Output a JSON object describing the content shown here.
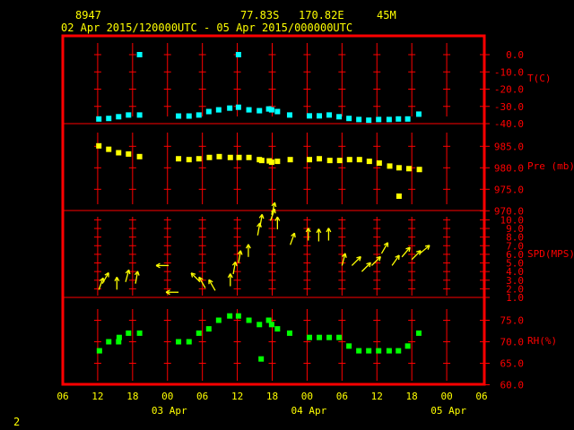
{
  "header": {
    "station": "8947",
    "lat": "77.83S",
    "lon": "170.82E",
    "elev": "45M",
    "range": "02 Apr 2015/120000UTC - 05 Apr 2015/000000UTC"
  },
  "footer": {
    "page": "2"
  },
  "colors": {
    "frame": "#ff0000",
    "text": "#ffff00",
    "temp": "#00ffff",
    "pres": "#ffff00",
    "wind": "#ffff00",
    "rh": "#00ff00"
  },
  "chart_data": {
    "type": "scatter",
    "title": "8947  77.83S 170.82E 45M",
    "x_units": "hours since 02 Apr 2015 00UTC",
    "xlim": [
      6,
      78
    ],
    "x_ticks": [
      {
        "h": 6,
        "label": "06"
      },
      {
        "h": 12,
        "label": "12"
      },
      {
        "h": 18,
        "label": "18"
      },
      {
        "h": 24,
        "label": "00"
      },
      {
        "h": 30,
        "label": "06"
      },
      {
        "h": 36,
        "label": "12"
      },
      {
        "h": 42,
        "label": "18"
      },
      {
        "h": 48,
        "label": "00"
      },
      {
        "h": 54,
        "label": "06"
      },
      {
        "h": 60,
        "label": "12"
      },
      {
        "h": 66,
        "label": "18"
      },
      {
        "h": 72,
        "label": "00"
      },
      {
        "h": 78,
        "label": "06"
      }
    ],
    "date_labels": [
      {
        "h": 24,
        "label": "03 Apr"
      },
      {
        "h": 48,
        "label": "04 Apr"
      },
      {
        "h": 72,
        "label": "05 Apr"
      }
    ],
    "panels": [
      {
        "id": "temp",
        "ylabel": "T(C)",
        "ylim": [
          -40,
          0
        ],
        "ticks": [
          "0.0",
          "-10.0",
          "-20.0",
          "-30.0",
          "-40.0"
        ],
        "tick_values": [
          0,
          -10,
          -20,
          -30,
          -40
        ],
        "points": [
          [
            12.2,
            -37.3
          ],
          [
            13.9,
            -37
          ],
          [
            15.6,
            -36
          ],
          [
            17.3,
            -35
          ],
          [
            19.2,
            -35
          ],
          [
            19.2,
            0
          ],
          [
            25.9,
            -35.6
          ],
          [
            27.7,
            -35.6
          ],
          [
            29.4,
            -35
          ],
          [
            31.1,
            -33
          ],
          [
            32.8,
            -32
          ],
          [
            34.7,
            -31
          ],
          [
            36.2,
            -30.5
          ],
          [
            36.2,
            0
          ],
          [
            38.0,
            -32
          ],
          [
            39.8,
            -32.5
          ],
          [
            41.4,
            -31.5
          ],
          [
            41.9,
            -32
          ],
          [
            42.9,
            -33
          ],
          [
            45.0,
            -35
          ],
          [
            48.4,
            -35.5
          ],
          [
            50.1,
            -35.5
          ],
          [
            51.8,
            -35
          ],
          [
            53.5,
            -36
          ],
          [
            55.2,
            -37
          ],
          [
            56.9,
            -37.6
          ],
          [
            58.6,
            -38
          ],
          [
            60.3,
            -37.6
          ],
          [
            62.1,
            -37.6
          ],
          [
            63.7,
            -37.3
          ],
          [
            65.3,
            -37.3
          ],
          [
            67.2,
            -34.5
          ]
        ]
      },
      {
        "id": "pres",
        "ylabel": "Pre (mb)",
        "ylim": [
          970,
          990
        ],
        "ticks": [
          "985.0",
          "980.0",
          "975.0",
          "970.0"
        ],
        "tick_values": [
          985,
          980,
          975,
          970
        ],
        "points": [
          [
            12.2,
            985.1
          ],
          [
            13.9,
            984.3
          ],
          [
            15.6,
            983.5
          ],
          [
            17.3,
            983.2
          ],
          [
            19.2,
            982.6
          ],
          [
            25.9,
            982.1
          ],
          [
            27.7,
            981.9
          ],
          [
            29.4,
            982.1
          ],
          [
            31.2,
            982.4
          ],
          [
            32.9,
            982.6
          ],
          [
            34.8,
            982.4
          ],
          [
            36.3,
            982.4
          ],
          [
            38.0,
            982.4
          ],
          [
            39.8,
            981.9
          ],
          [
            40.2,
            981.7
          ],
          [
            41.5,
            981.6
          ],
          [
            41.9,
            981.3
          ],
          [
            42.9,
            981.5
          ],
          [
            45.1,
            981.9
          ],
          [
            48.4,
            981.9
          ],
          [
            50.1,
            982.1
          ],
          [
            51.9,
            981.7
          ],
          [
            53.6,
            981.7
          ],
          [
            55.3,
            981.9
          ],
          [
            57.0,
            981.9
          ],
          [
            58.7,
            981.5
          ],
          [
            60.4,
            981.1
          ],
          [
            62.2,
            980.4
          ],
          [
            63.8,
            980.0
          ],
          [
            65.5,
            979.8
          ],
          [
            67.3,
            979.6
          ],
          [
            63.8,
            973.4
          ]
        ]
      },
      {
        "id": "wind",
        "ylabel": "SPD(MPS)",
        "ylim": [
          1,
          10
        ],
        "ticks": [
          "10.0",
          "9.0",
          "8.0",
          "7.0",
          "6.0",
          "5.0",
          "4.0",
          "3.0",
          "2.0",
          "1.0"
        ],
        "tick_values": [
          10,
          9,
          8,
          7,
          6,
          5,
          4,
          3,
          2,
          1
        ],
        "points_h_speed_dirdeg": [
          [
            12.2,
            1.9,
            20
          ],
          [
            12.8,
            2.6,
            30
          ],
          [
            15.3,
            1.9,
            0
          ],
          [
            16.8,
            2.8,
            15
          ],
          [
            18.5,
            2.6,
            10
          ],
          [
            24.2,
            4.7,
            270
          ],
          [
            25.9,
            1.6,
            270
          ],
          [
            29.6,
            2.8,
            315
          ],
          [
            30.5,
            2.1,
            330
          ],
          [
            32.2,
            1.8,
            330
          ],
          [
            34.8,
            2.3,
            0
          ],
          [
            35.3,
            3.7,
            10
          ],
          [
            36.2,
            5.0,
            10
          ],
          [
            37.9,
            5.7,
            0
          ],
          [
            39.5,
            8.2,
            10
          ],
          [
            39.9,
            9.2,
            10
          ],
          [
            41.7,
            9.9,
            20
          ],
          [
            41.9,
            10.6,
            15
          ],
          [
            42.9,
            8.9,
            0
          ],
          [
            45.1,
            7.1,
            20
          ],
          [
            48.2,
            7.6,
            0
          ],
          [
            50.0,
            7.5,
            0
          ],
          [
            51.7,
            7.6,
            0
          ],
          [
            54.0,
            4.7,
            15
          ],
          [
            55.7,
            4.7,
            45
          ],
          [
            57.4,
            4.0,
            45
          ],
          [
            59.1,
            4.7,
            45
          ],
          [
            60.8,
            6.1,
            30
          ],
          [
            62.6,
            4.7,
            35
          ],
          [
            64.3,
            5.7,
            40
          ],
          [
            66.0,
            5.4,
            45
          ],
          [
            67.4,
            6.1,
            50
          ]
        ]
      },
      {
        "id": "rh",
        "ylabel": "RH(%)",
        "ylim": [
          60,
          80
        ],
        "ticks": [
          "75.0",
          "70.0",
          "65.0",
          "60.0"
        ],
        "tick_values": [
          75,
          70,
          65,
          60
        ],
        "points": [
          [
            12.3,
            67.9
          ],
          [
            13.9,
            70
          ],
          [
            15.6,
            70
          ],
          [
            15.7,
            71
          ],
          [
            17.3,
            72
          ],
          [
            19.2,
            72
          ],
          [
            25.9,
            70
          ],
          [
            27.7,
            70
          ],
          [
            29.4,
            72
          ],
          [
            31.1,
            73
          ],
          [
            32.8,
            75
          ],
          [
            34.7,
            76
          ],
          [
            36.2,
            76
          ],
          [
            38.0,
            75
          ],
          [
            39.8,
            74
          ],
          [
            40.1,
            66
          ],
          [
            41.4,
            75
          ],
          [
            41.9,
            74
          ],
          [
            42.9,
            73
          ],
          [
            45.0,
            72
          ],
          [
            48.4,
            71
          ],
          [
            50.1,
            71
          ],
          [
            51.8,
            71
          ],
          [
            53.5,
            71
          ],
          [
            55.2,
            69
          ],
          [
            56.9,
            67.9
          ],
          [
            58.6,
            67.9
          ],
          [
            60.3,
            67.9
          ],
          [
            62.1,
            67.9
          ],
          [
            63.7,
            67.9
          ],
          [
            65.3,
            69
          ],
          [
            67.2,
            72
          ]
        ]
      }
    ]
  }
}
